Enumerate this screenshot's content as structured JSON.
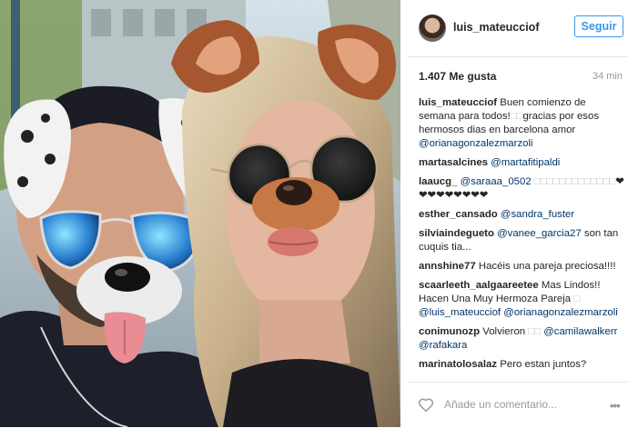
{
  "header": {
    "username": "luis_mateucciof",
    "follow_label": "Seguir"
  },
  "stats": {
    "likes": "1.407 Me gusta",
    "time": "34 min"
  },
  "comments": [
    {
      "user": "luis_mateucciof",
      "parts": [
        {
          "t": "Buen comienzo de semana para todos!",
          "c": "txt"
        },
        {
          "t": "□□",
          "c": "g"
        },
        {
          "t": "gracias por esos hermosos dias en barcelona amor ",
          "c": "txt"
        },
        {
          "t": "@orianagonzalezmarzoli",
          "c": "m"
        }
      ]
    },
    {
      "user": "martasalcines",
      "parts": [
        {
          "t": "@martafitipaldi",
          "c": "m"
        }
      ]
    },
    {
      "user": "laaucg_",
      "parts": [
        {
          "t": "@saraaa_0502",
          "c": "m"
        },
        {
          "t": " □□□□□□□□□□□□□",
          "c": "g"
        },
        {
          "t": "❤❤❤❤❤❤❤❤❤",
          "c": "txt"
        }
      ]
    },
    {
      "user": "esther_cansado",
      "parts": [
        {
          "t": "@sandra_fuster",
          "c": "m"
        }
      ]
    },
    {
      "user": "silviaindegueto",
      "parts": [
        {
          "t": "@vanee_garcia27",
          "c": "m"
        },
        {
          "t": " son tan cuquis tia...",
          "c": "txt"
        }
      ]
    },
    {
      "user": "annshine77",
      "parts": [
        {
          "t": "Hacéis una pareja preciosa!!!!",
          "c": "txt"
        }
      ]
    },
    {
      "user": "scaarleeth_aalgaareetee",
      "parts": [
        {
          "t": "Mas Lindos!! Hacen Una Muy Hermoza Pareja ",
          "c": "txt"
        },
        {
          "t": "□",
          "c": "g"
        },
        {
          "t": " ",
          "c": "txt"
        },
        {
          "t": "@luis_mateucciof",
          "c": "m"
        },
        {
          "t": " ",
          "c": "txt"
        },
        {
          "t": "@orianagonzalezmarzoli",
          "c": "m"
        }
      ]
    },
    {
      "user": "conimunozp",
      "parts": [
        {
          "t": "Volvieron ",
          "c": "txt"
        },
        {
          "t": "□□",
          "c": "g"
        },
        {
          "t": " ",
          "c": "txt"
        },
        {
          "t": "@camilawalkerr",
          "c": "m"
        },
        {
          "t": " ",
          "c": "txt"
        },
        {
          "t": "@rafakara",
          "c": "m"
        }
      ]
    },
    {
      "user": "marinatolosalaz",
      "parts": [
        {
          "t": "Pero estan juntos?",
          "c": "txt"
        }
      ]
    }
  ],
  "footer": {
    "add_comment_placeholder": "Añade un comentario...",
    "more_label": "•••"
  }
}
